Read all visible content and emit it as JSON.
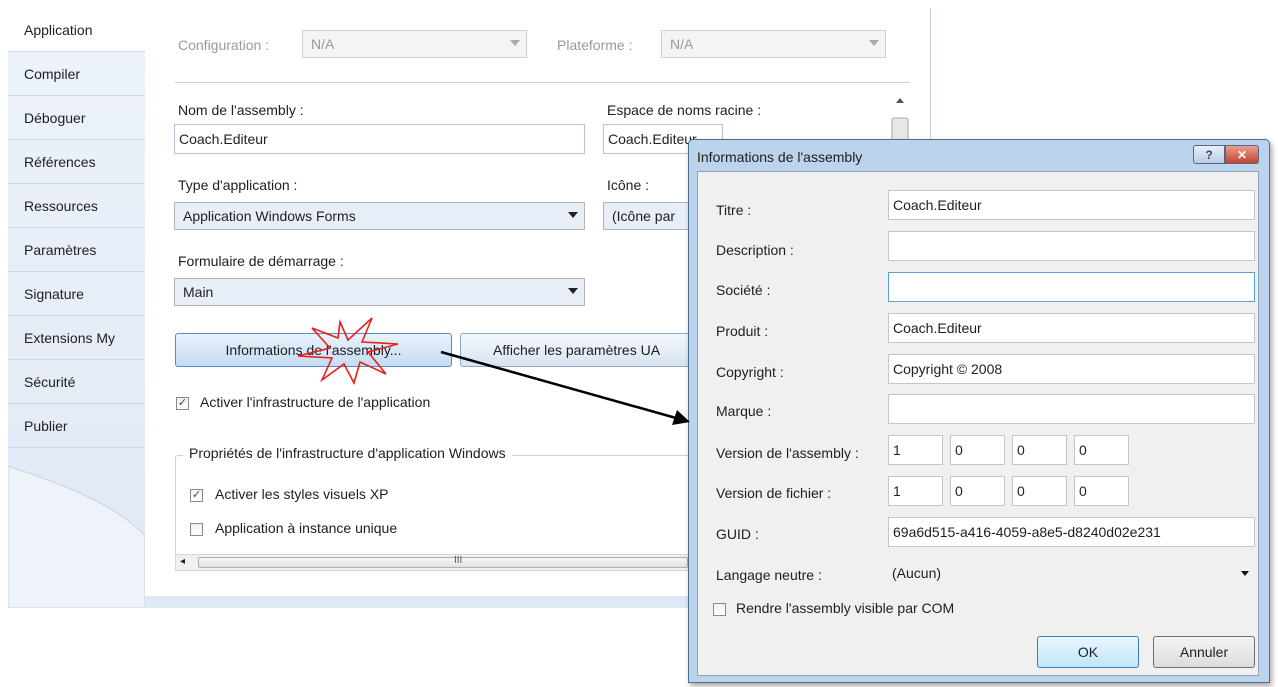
{
  "tabs": [
    "Application",
    "Compiler",
    "Déboguer",
    "Références",
    "Ressources",
    "Paramètres",
    "Signature",
    "Extensions My",
    "Sécurité",
    "Publier"
  ],
  "config": {
    "configuration_label": "Configuration :",
    "configuration_value": "N/A",
    "platform_label": "Plateforme :",
    "platform_value": "N/A"
  },
  "form": {
    "assembly_name_label": "Nom de l'assembly :",
    "assembly_name_value": "Coach.Editeur",
    "root_namespace_label": "Espace de noms racine :",
    "root_namespace_value": "Coach.Editeur",
    "app_type_label": "Type d'application :",
    "app_type_value": "Application Windows Forms",
    "icon_label": "Icône :",
    "icon_value": "(Icône par",
    "startup_form_label": "Formulaire de démarrage :",
    "startup_form_value": "Main",
    "assembly_info_button": "Informations de l'assembly...",
    "uac_button": "Afficher les paramètres UA",
    "enable_framework_label": "Activer l'infrastructure de l'application",
    "enable_framework_checked": true,
    "group_title": "Propriétés de l'infrastructure d'application Windows",
    "xp_styles_label": "Activer les styles visuels XP",
    "xp_styles_checked": true,
    "single_instance_label": "Application à instance unique",
    "single_instance_checked": false,
    "scroll_grip": "III"
  },
  "dialog": {
    "title": "Informations de l'assembly",
    "help_glyph": "?",
    "close_glyph": "✕",
    "title_label": "Titre :",
    "title_value": "Coach.Editeur",
    "description_label": "Description :",
    "description_value": "",
    "company_label": "Société :",
    "company_value": "",
    "product_label": "Produit :",
    "product_value": "Coach.Editeur",
    "copyright_label": "Copyright :",
    "copyright_value": "Copyright ©  2008",
    "trademark_label": "Marque :",
    "trademark_value": "",
    "assembly_version_label": "Version de l'assembly :",
    "assembly_version": [
      "1",
      "0",
      "0",
      "0"
    ],
    "file_version_label": "Version de fichier :",
    "file_version": [
      "1",
      "0",
      "0",
      "0"
    ],
    "guid_label": "GUID :",
    "guid_value": "69a6d515-a416-4059-a8e5-d8240d02e231",
    "neutral_language_label": "Langage neutre :",
    "neutral_language_value": "(Aucun)",
    "com_visible_label": "Rendre l'assembly visible par COM",
    "com_visible_checked": false,
    "ok_button": "OK",
    "cancel_button": "Annuler"
  },
  "colors": {
    "tab_bg": "#dfe8f4",
    "dialog_frame": "#bcd3ec",
    "close_button": "#c6442d",
    "highlight_star": "#e8201b"
  }
}
